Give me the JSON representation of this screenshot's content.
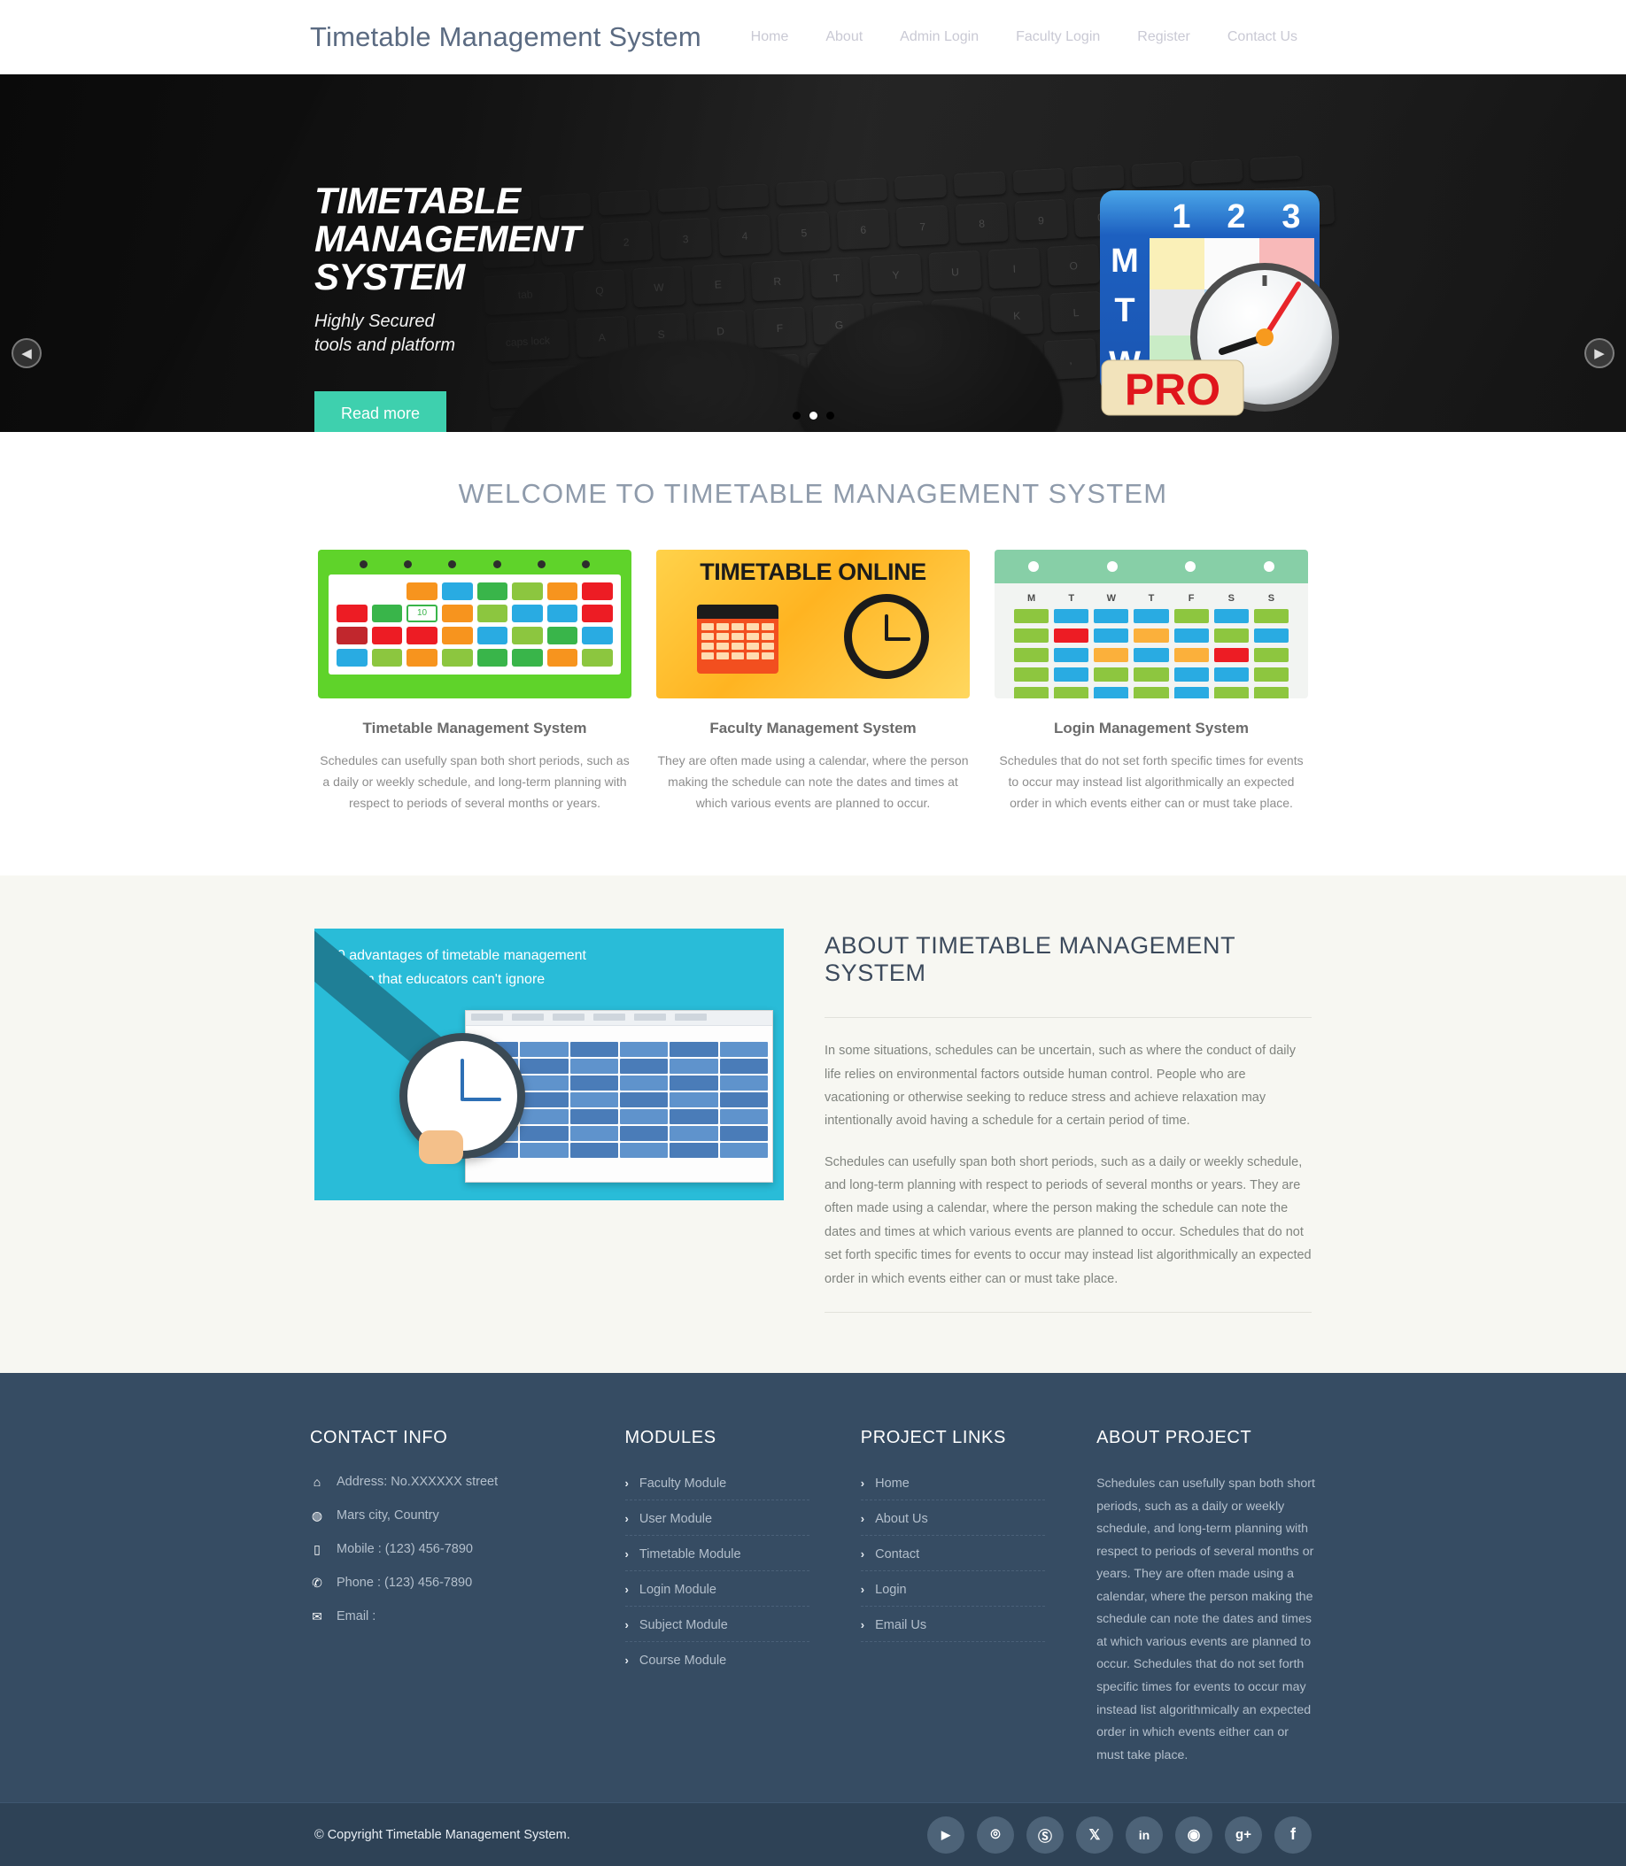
{
  "header": {
    "logo": "Timetable Management System",
    "nav": [
      {
        "label": "Home"
      },
      {
        "label": "About"
      },
      {
        "label": "Admin Login"
      },
      {
        "label": "Faculty Login"
      },
      {
        "label": "Register"
      },
      {
        "label": "Contact Us"
      }
    ]
  },
  "hero": {
    "title_line1": "TIMETABLE",
    "title_line2": "MANAGEMENT",
    "title_line3": "SYSTEM",
    "subtitle_line1": "Highly Secured",
    "subtitle_line2": "tools and platform",
    "button_label": "Read more",
    "prev_icon": "chevron-left-icon",
    "next_icon": "chevron-right-icon",
    "slide_count": 3,
    "active_slide": 2,
    "badge_days": [
      "M",
      "T",
      "W"
    ],
    "badge_numbers": [
      "1",
      "2",
      "3"
    ],
    "badge_text": "PRO",
    "accent_color": "#3ed0ae"
  },
  "welcome": {
    "heading": "WELCOME TO TIMETABLE MANAGEMENT SYSTEM",
    "cards": [
      {
        "title": "Timetable Management System",
        "text": "Schedules can usefully span both short periods, such as a daily or weekly schedule, and long-term planning with respect to periods of several months or years.",
        "image_alt": "green-calendar-grid"
      },
      {
        "title": "Faculty Management System",
        "text": "They are often made using a calendar, where the person making the schedule can note the dates and times at which various events are planned to occur.",
        "image_alt": "timetable-online-banner",
        "image_caption": "TIMETABLE ONLINE"
      },
      {
        "title": "Login Management System",
        "text": "Schedules that do not set forth specific times for events to occur may instead list algorithmically an expected order in which events either can or must take place.",
        "image_alt": "weekly-calendar-grid",
        "weekday_labels": [
          "M",
          "T",
          "W",
          "T",
          "F",
          "S",
          "S"
        ]
      }
    ]
  },
  "about": {
    "image_caption_line1": "10 advantages of timetable management",
    "image_caption_line2": "system that  educators can't ignore",
    "heading": "ABOUT TIMETABLE MANAGEMENT SYSTEM",
    "paragraph1": "In some situations, schedules can be uncertain, such as where the conduct of daily life relies on environmental factors outside human control. People who are vacationing or otherwise seeking to reduce stress and achieve relaxation may intentionally avoid having a schedule for a certain period of time.",
    "paragraph2": "Schedules can usefully span both short periods, such as a daily or weekly schedule, and long-term planning with respect to periods of several months or years. They are often made using a calendar, where the person making the schedule can note the dates and times at which various events are planned to occur. Schedules that do not set forth specific times for events to occur may instead list algorithmically an expected order in which events either can or must take place."
  },
  "footer": {
    "contact": {
      "title": "CONTACT INFO",
      "items": [
        {
          "icon": "home-icon",
          "text": "Address: No.XXXXXX street"
        },
        {
          "icon": "globe-icon",
          "text": "Mars city, Country"
        },
        {
          "icon": "mobile-icon",
          "text": "Mobile : (123) 456-7890"
        },
        {
          "icon": "phone-icon",
          "text": "Phone : (123) 456-7890"
        },
        {
          "icon": "envelope-icon",
          "text": "Email :"
        }
      ]
    },
    "modules": {
      "title": "MODULES",
      "items": [
        {
          "label": "Faculty Module"
        },
        {
          "label": "User Module"
        },
        {
          "label": "Timetable Module"
        },
        {
          "label": "Login Module"
        },
        {
          "label": "Subject Module"
        },
        {
          "label": "Course Module"
        }
      ]
    },
    "project_links": {
      "title": "PROJECT LINKS",
      "items": [
        {
          "label": "Home"
        },
        {
          "label": "About Us"
        },
        {
          "label": "Contact"
        },
        {
          "label": "Login"
        },
        {
          "label": "Email Us"
        }
      ]
    },
    "about_project": {
      "title": "ABOUT PROJECT",
      "text": "Schedules can usefully span both short periods, such as a daily or weekly schedule, and long-term planning with respect to periods of several months or years. They are often made using a calendar, where the person making the schedule can note the dates and times at which various events are planned to occur. Schedules that do not set forth specific times for events to occur may instead list algorithmically an expected order in which events either can or must take place."
    },
    "copyright": "© Copyright Timetable Management System.",
    "socials": [
      {
        "name": "youtube-icon",
        "glyph": "▶"
      },
      {
        "name": "github-icon",
        "glyph": "⌾"
      },
      {
        "name": "skype-icon",
        "glyph": "S"
      },
      {
        "name": "twitter-icon",
        "glyph": "🐦"
      },
      {
        "name": "linkedin-icon",
        "glyph": "in"
      },
      {
        "name": "dribbble-icon",
        "glyph": "◉"
      },
      {
        "name": "google-plus-icon",
        "glyph": "g+"
      },
      {
        "name": "facebook-icon",
        "glyph": "f"
      }
    ],
    "bg_color": "#364c63"
  }
}
